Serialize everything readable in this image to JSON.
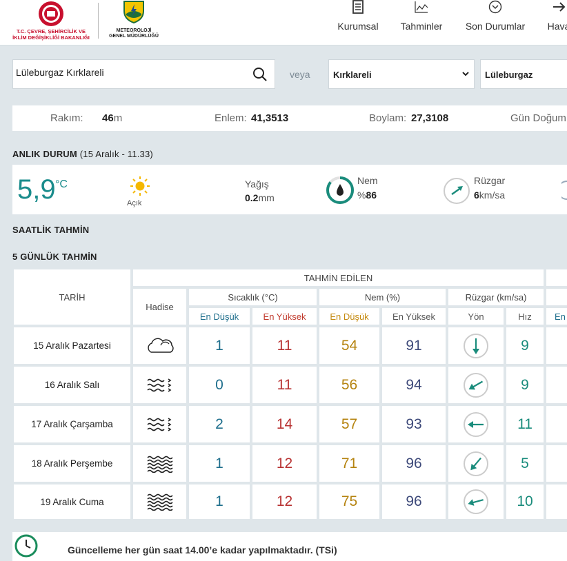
{
  "header": {
    "ministry_logo_text_1": "T.C. ÇEVRE, ŞEHİRCİLİK VE",
    "ministry_logo_text_2": "İKLİM DEĞİŞİKLİĞİ BAKANLIĞI",
    "mgm_logo_text_1": "METEOROLOJİ",
    "mgm_logo_text_2": "GENEL MÜDÜRLÜĞÜ",
    "nav": [
      {
        "label": "Kurumsal",
        "icon": "document-icon"
      },
      {
        "label": "Tahminler",
        "icon": "chart-icon"
      },
      {
        "label": "Son Durumlar",
        "icon": "chevron-circle-icon"
      },
      {
        "label": "Hava",
        "icon": "plane-icon"
      }
    ]
  },
  "search": {
    "value": "Lüleburgaz Kırklareli",
    "veya": "veya",
    "province": "Kırklareli",
    "district": "Lüleburgaz"
  },
  "info": {
    "rakim_label": "Rakım:",
    "rakim_value": "46",
    "rakim_unit": "m",
    "enlem_label": "Enlem:",
    "enlem_value": "41,3513",
    "boylam_label": "Boylam:",
    "boylam_value": "27,3108",
    "gun_dogumu_label": "Gün Doğum"
  },
  "current": {
    "title": "ANLIK DURUM",
    "subtitle": "(15 Aralık - 11.33)",
    "temp": "5,9",
    "temp_unit": "°C",
    "condition": "Açık",
    "yagis_label": "Yağış",
    "yagis_value": "0.2",
    "yagis_unit": "mm",
    "nem_label": "Nem",
    "nem_prefix": "%",
    "nem_value": "86",
    "nem_fraction": 0.86,
    "ruzgar_label": "Rüzgar",
    "ruzgar_value": "6",
    "ruzgar_unit": "km/sa"
  },
  "hourly_title": "SAATLİK TAHMİN",
  "forecast": {
    "title": "5 GÜNLÜK TAHMİN",
    "tahmin_edilen": "TAHMİN EDİLEN",
    "col_tarih": "TARİH",
    "col_hadise": "Hadise",
    "col_sicaklik": "Sıcaklık (°C)",
    "col_nem": "Nem (%)",
    "col_ruzgar": "Rüzgar (km/sa)",
    "sub_en_dusuk": "En Düşük",
    "sub_en_yuksek": "En Yüksek",
    "sub_yon": "Yön",
    "sub_hiz": "Hız",
    "sub_en_cut": "En",
    "rows": [
      {
        "date": "15 Aralık Pazartesi",
        "hadise": "cloudy",
        "t_min": "1",
        "t_max": "11",
        "h_min": "54",
        "h_max": "91",
        "wind_dir_deg": 180,
        "wind_speed": "9"
      },
      {
        "date": "16 Aralık Salı",
        "hadise": "fog",
        "t_min": "0",
        "t_max": "11",
        "h_min": "56",
        "h_max": "94",
        "wind_dir_deg": 240,
        "wind_speed": "9"
      },
      {
        "date": "17 Aralık Çarşamba",
        "hadise": "fog",
        "t_min": "2",
        "t_max": "14",
        "h_min": "57",
        "h_max": "93",
        "wind_dir_deg": 270,
        "wind_speed": "11"
      },
      {
        "date": "18 Aralık Perşembe",
        "hadise": "haze",
        "t_min": "1",
        "t_max": "12",
        "h_min": "71",
        "h_max": "96",
        "wind_dir_deg": 220,
        "wind_speed": "5"
      },
      {
        "date": "19 Aralık Cuma",
        "hadise": "haze",
        "t_min": "1",
        "t_max": "12",
        "h_min": "75",
        "h_max": "96",
        "wind_dir_deg": 255,
        "wind_speed": "10"
      }
    ]
  },
  "footer": {
    "message": "Güncelleme her gün saat 14.00’e kadar yapılmaktadır. (TSi)"
  },
  "colors": {
    "teal": "#1a8c8c",
    "red": "#c0392b",
    "gold": "#c58a10",
    "navy": "#3e4a7a",
    "background": "#dfe6ea"
  }
}
